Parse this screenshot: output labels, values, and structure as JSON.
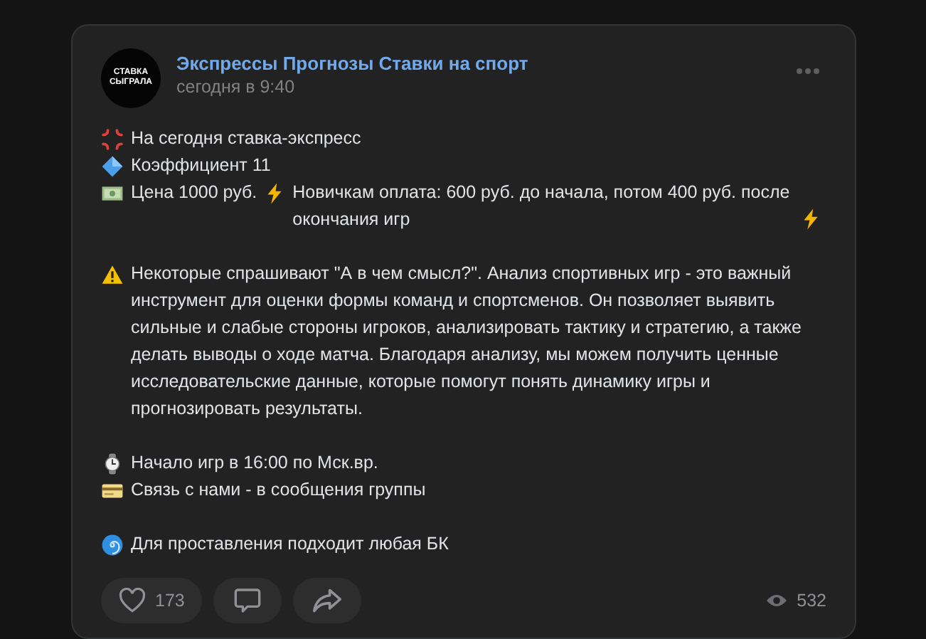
{
  "post": {
    "author": "Экспрессы Прогнозы Ставки на спорт",
    "time": "сегодня в 9:40",
    "avatar_lines": [
      "СТАВКА",
      "СЫГРАЛА"
    ],
    "paragraphs": [
      [
        {
          "segments": [
            "На сегодня ставка-экспресс"
          ]
        },
        {
          "segments": [
            "Коэффициент 11"
          ]
        },
        {
          "segments": [
            "Цена 1000 руб.",
            "Новичкам оплата: 600 руб. до начала, потом 400 руб. после окончания игр"
          ]
        }
      ],
      [
        {
          "segments": [
            "Некоторые спрашивают \"А в чем смысл?\". Анализ спортивных игр - это важный инструмент для оценки формы команд и спортсменов. Он позволяет выявить сильные и слабые стороны игроков, анализировать тактику и стратегию, а также делать выводы о ходе матча. Благодаря анализу, мы можем получить ценные исследовательские данные, которые помогут понять динамику игры и прогнозировать результаты."
          ]
        }
      ],
      [
        {
          "segments": [
            "Начало игр в 16:00 по Мск.вр."
          ]
        },
        {
          "segments": [
            "Связь с нами - в сообщения группы"
          ]
        }
      ],
      [
        {
          "segments": [
            "Для проставления подходит любая БК"
          ]
        }
      ]
    ],
    "likes": "173",
    "views": "532"
  }
}
